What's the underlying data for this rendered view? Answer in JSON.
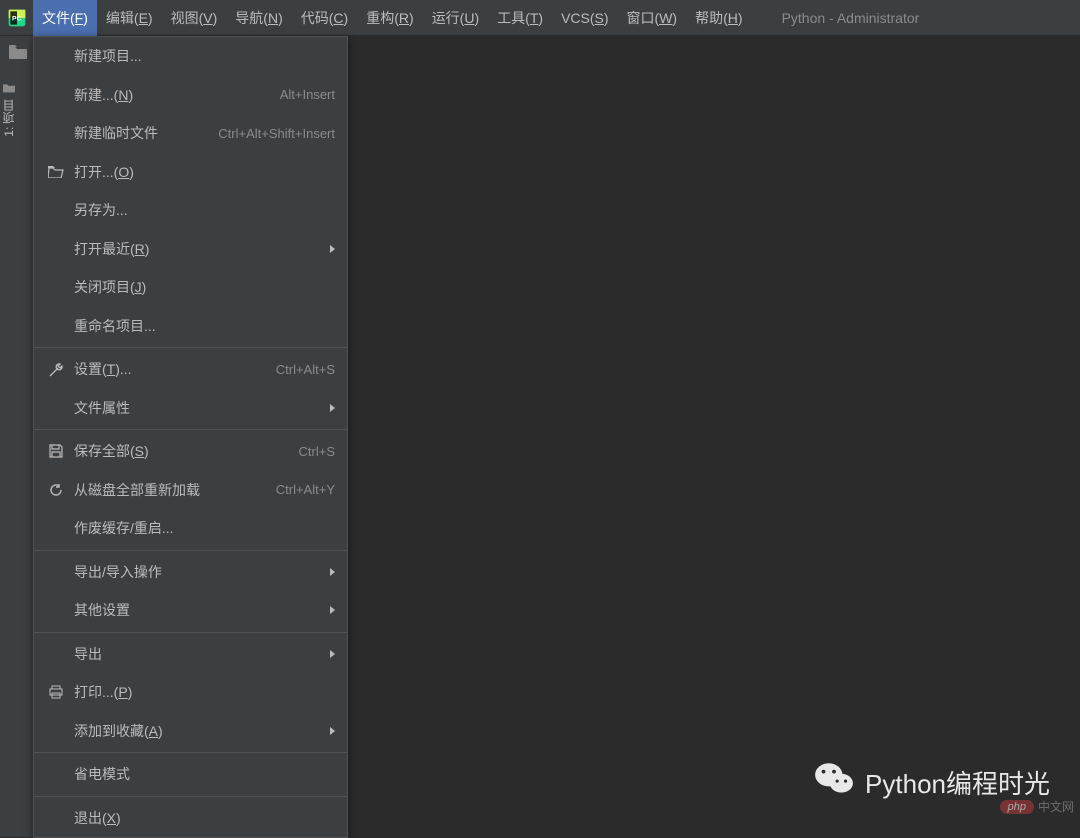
{
  "window": {
    "title": "Python - Administrator"
  },
  "menubar": {
    "file": {
      "label": "文件(",
      "mn": "F",
      "tail": ")"
    },
    "edit": {
      "label": "编辑(",
      "mn": "E",
      "tail": ")"
    },
    "view": {
      "label": "视图(",
      "mn": "V",
      "tail": ")"
    },
    "nav": {
      "label": "导航(",
      "mn": "N",
      "tail": ")"
    },
    "code": {
      "label": "代码(",
      "mn": "C",
      "tail": ")"
    },
    "refac": {
      "label": "重构(",
      "mn": "R",
      "tail": ")"
    },
    "run": {
      "label": "运行(",
      "mn": "U",
      "tail": ")"
    },
    "tools": {
      "label": "工具(",
      "mn": "T",
      "tail": ")"
    },
    "vcs": {
      "label": "VCS(",
      "mn": "S",
      "tail": ")"
    },
    "wind": {
      "label": "窗口(",
      "mn": "W",
      "tail": ")"
    },
    "help": {
      "label": "帮助(",
      "mn": "H",
      "tail": ")"
    }
  },
  "sidebar": {
    "project_label": "1: 项目"
  },
  "file_menu": {
    "new_project": "新建项目...",
    "new": {
      "label": "新建...(",
      "mn": "N",
      "tail": ")",
      "shortcut": "Alt+Insert"
    },
    "scratch": {
      "label": "新建临时文件",
      "shortcut": "Ctrl+Alt+Shift+Insert"
    },
    "open": {
      "label": "打开...(",
      "mn": "O",
      "tail": ")"
    },
    "save_as": "另存为...",
    "open_recent": {
      "label": "打开最近(",
      "mn": "R",
      "tail": ")"
    },
    "close_project": {
      "label": "关闭项目(",
      "mn": "J",
      "tail": ")"
    },
    "rename_project": "重命名项目...",
    "settings": {
      "label": "设置(",
      "mn": "T",
      "tail": ")...",
      "shortcut": "Ctrl+Alt+S"
    },
    "file_props": "文件属性",
    "save_all": {
      "label": "保存全部(",
      "mn": "S",
      "tail": ")",
      "shortcut": "Ctrl+S"
    },
    "reload": {
      "label": "从磁盘全部重新加载",
      "shortcut": "Ctrl+Alt+Y"
    },
    "invalidate": "作废缓存/重启...",
    "export_import": "导出/导入操作",
    "other_settings": "其他设置",
    "export": "导出",
    "print": {
      "label": "打印...(",
      "mn": "P",
      "tail": ")"
    },
    "add_favorites": {
      "label": "添加到收藏(",
      "mn": "A",
      "tail": ")"
    },
    "power_save": "省电模式",
    "exit": {
      "label": "退出(",
      "mn": "X",
      "tail": ")"
    }
  },
  "watermark": {
    "text": "Python编程时光"
  },
  "php_badge": {
    "pill": "php",
    "text": "中文网"
  }
}
